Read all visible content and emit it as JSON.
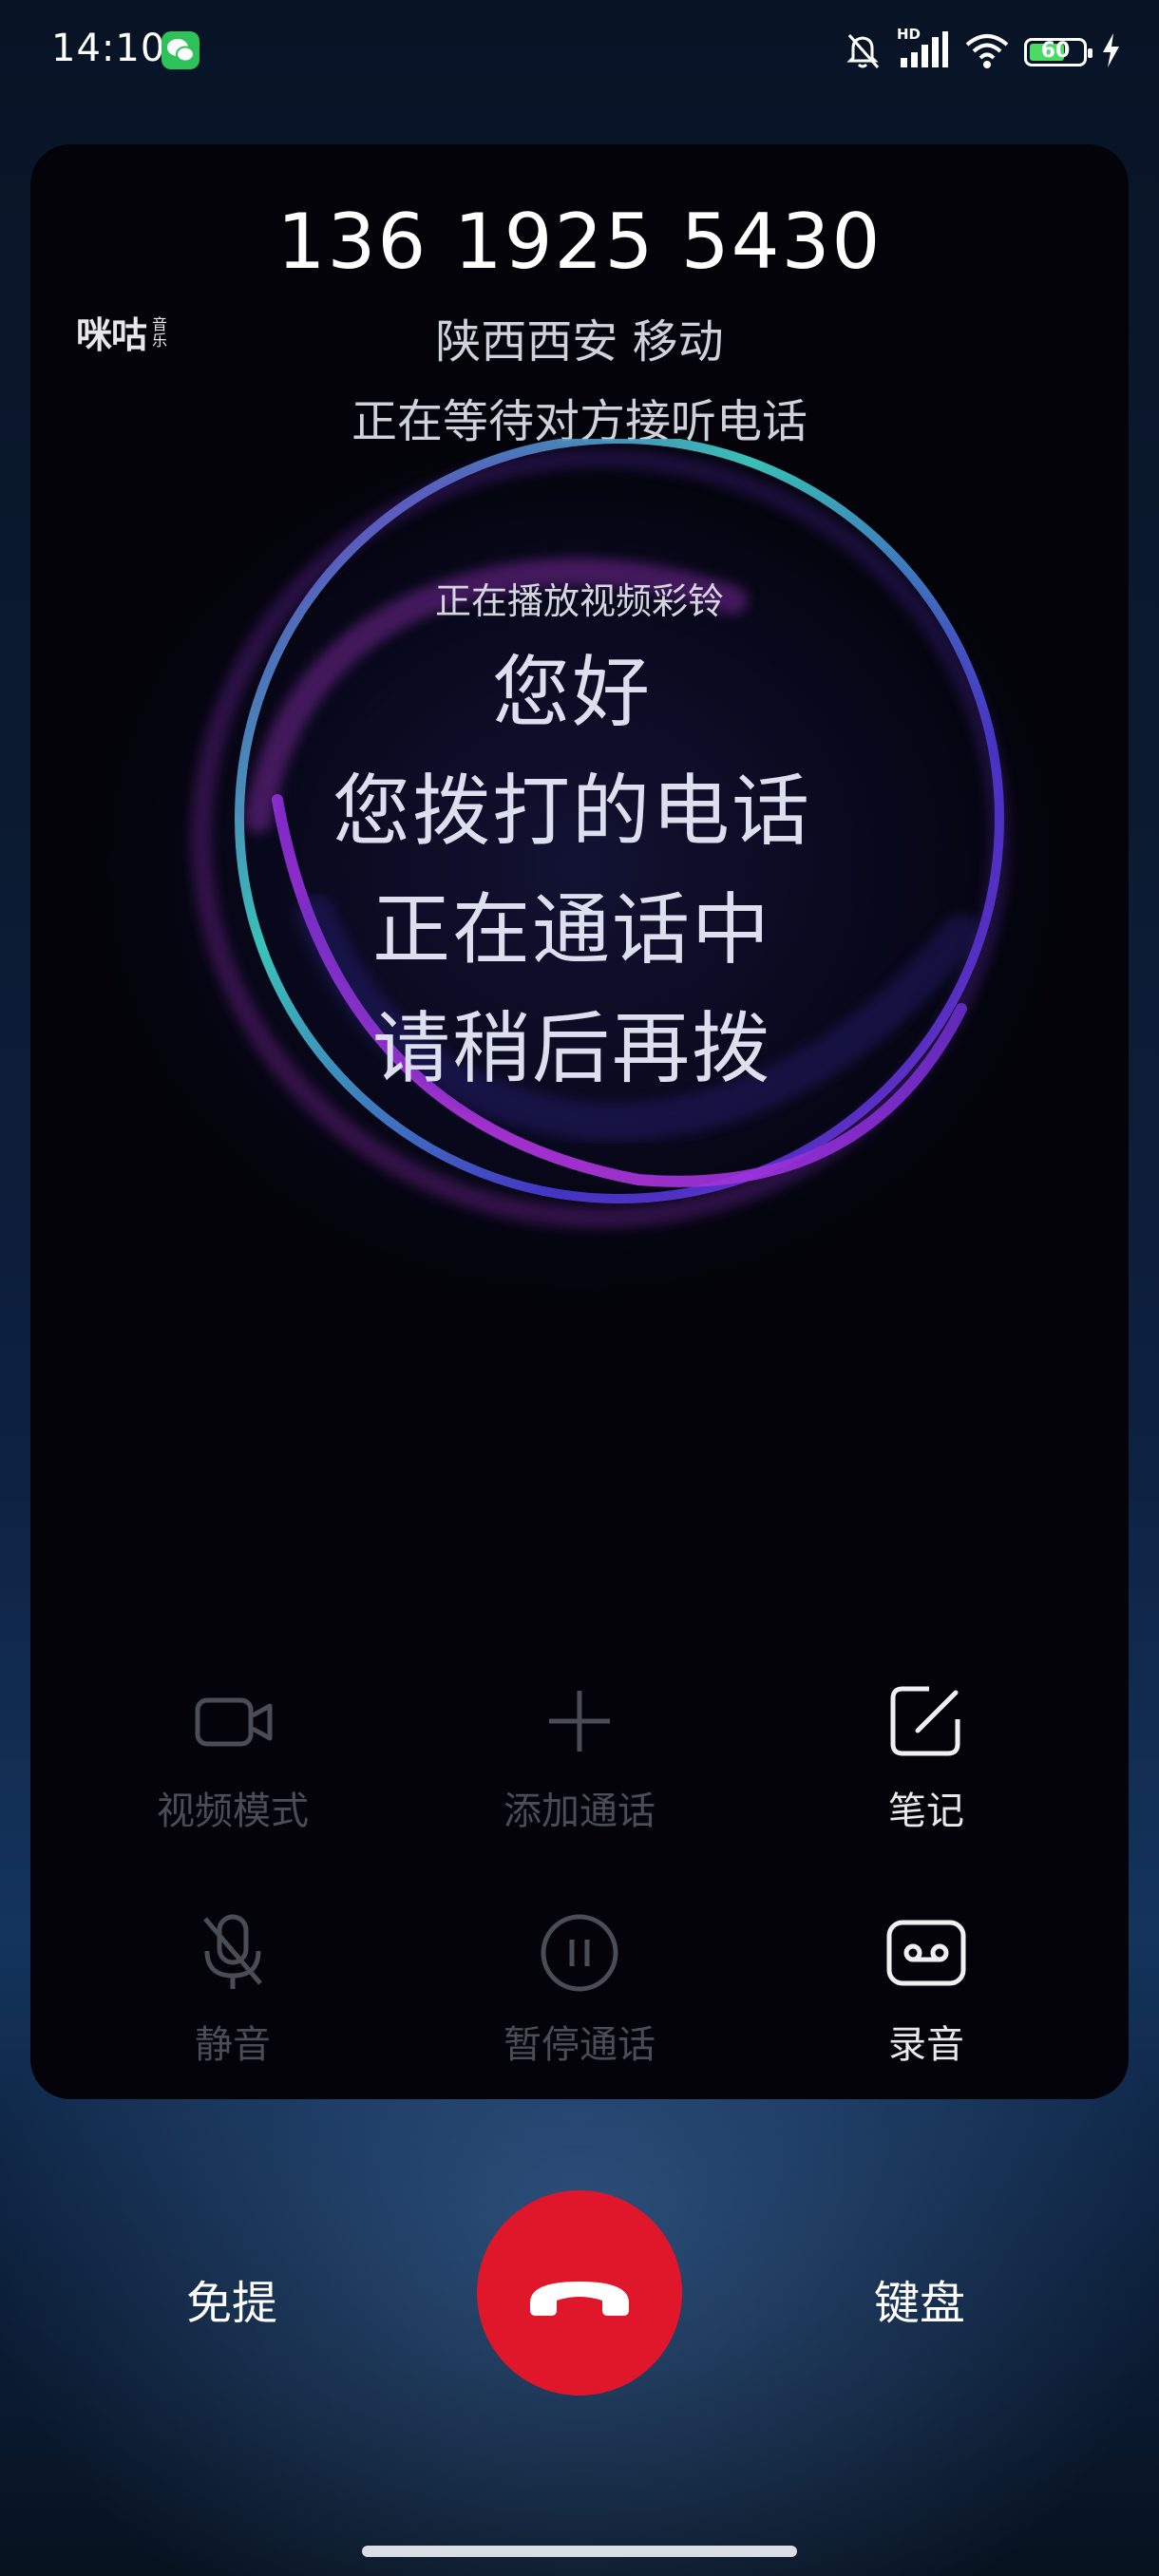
{
  "status_bar": {
    "time": "14:10",
    "hd_label": "HD",
    "battery_level": "60",
    "icons": [
      "wechat-icon",
      "mute-bell-icon",
      "signal-icon",
      "wifi-icon",
      "battery-icon",
      "charging-icon"
    ]
  },
  "call": {
    "number": "136 1925 5430",
    "location": "陕西西安 移动",
    "status": "正在等待对方接听电话",
    "provider_logo": "咪咕",
    "provider_logo_sub": "音乐"
  },
  "ringtone": {
    "label": "正在播放视频彩铃",
    "lines": [
      "您好",
      "您拨打的电话",
      "正在通话中",
      "请稍后再拨"
    ]
  },
  "controls": {
    "video_mode": "视频模式",
    "add_call": "添加通话",
    "notes": "笔记",
    "mute": "静音",
    "hold": "暂停通话",
    "record": "录音"
  },
  "bottom": {
    "speaker": "免提",
    "keypad": "键盘"
  },
  "colors": {
    "hangup": "#e0162b",
    "disabled_text": "#4a4d55",
    "accent_teal": "#3fd7c8",
    "accent_purple": "#b43be0"
  }
}
